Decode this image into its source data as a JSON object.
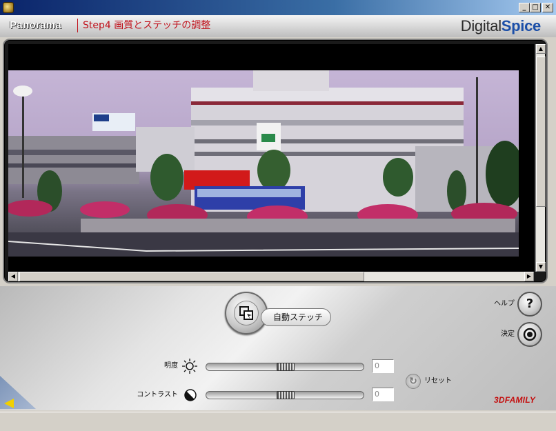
{
  "window": {
    "minimize_label": "_",
    "maximize_label": "□",
    "close_label": "✕"
  },
  "header": {
    "title": "Panorama",
    "step_title": "Step4 画質とステッチの調整",
    "logo_left": "Digital",
    "logo_right": "Spice"
  },
  "preview": {
    "image": "panorama-station-plaza"
  },
  "controls": {
    "auto_stitch_label": "自動ステッチ",
    "help_label": "ヘルプ",
    "help_glyph": "?",
    "ok_label": "決定",
    "brightness_label": "明度",
    "brightness_value": "0",
    "contrast_label": "コントラスト",
    "contrast_value": "0",
    "reset_label": "リセット",
    "brand": "3DFAMILY"
  },
  "colors": {
    "accent_red": "#c0101a",
    "logo_blue": "#1c4fa8",
    "back_arrow": "#f1d000"
  }
}
